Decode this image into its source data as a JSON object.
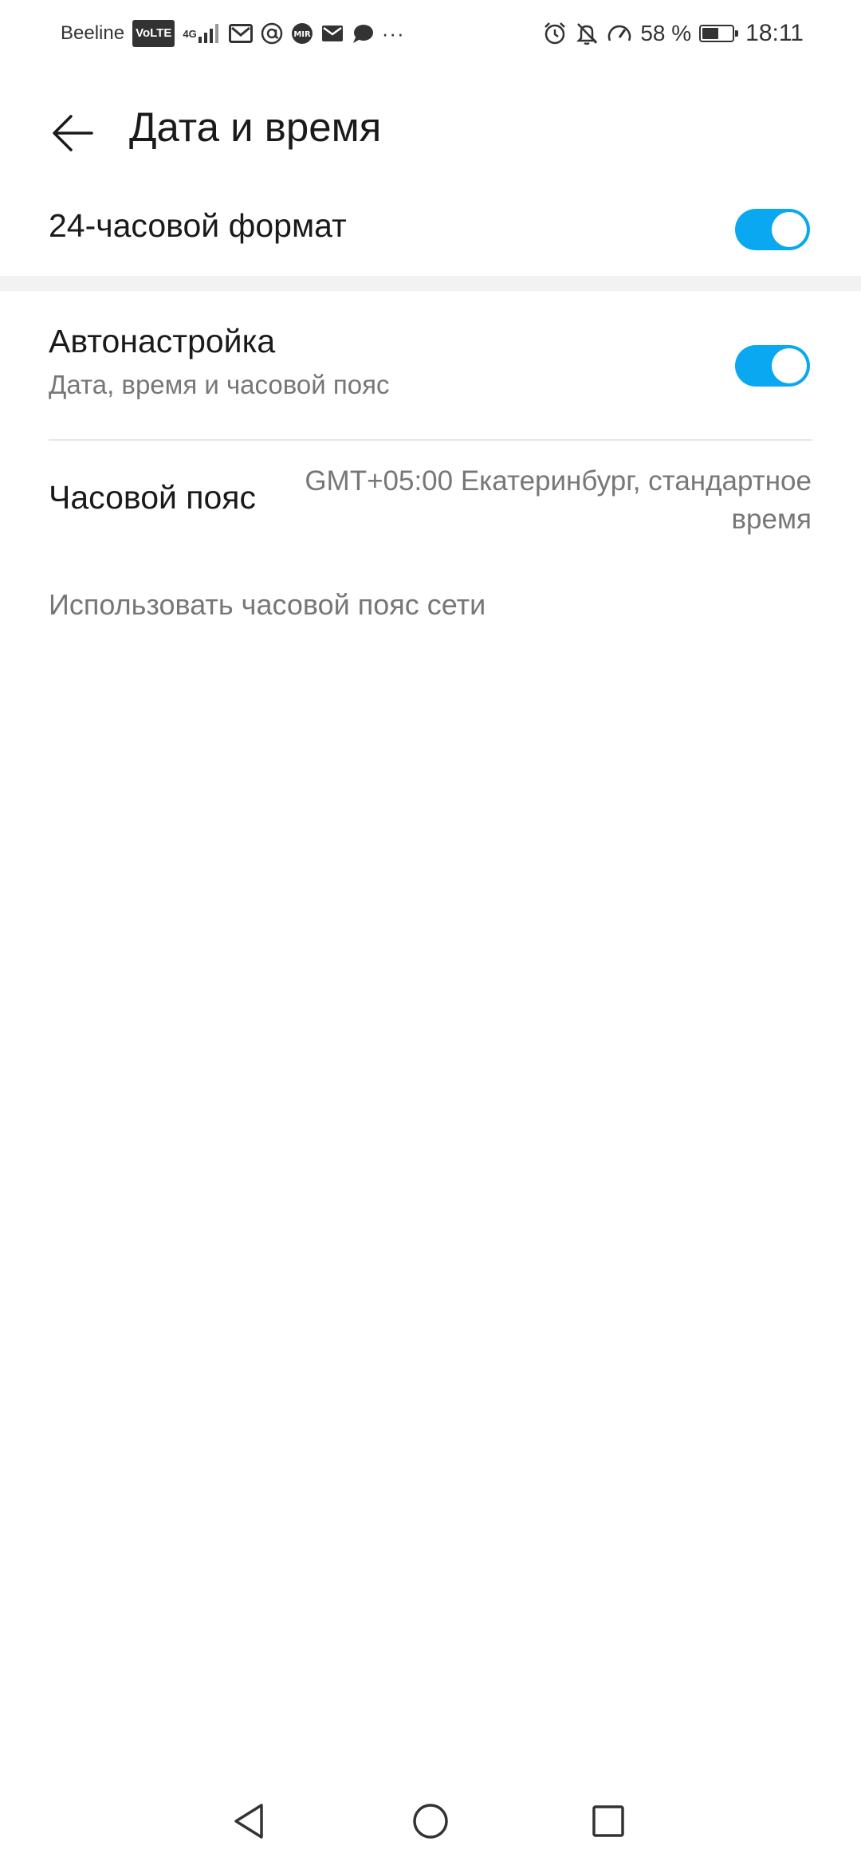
{
  "status_bar": {
    "carrier": "Beeline",
    "volte": "VoLTE",
    "network": "4G",
    "battery_percent": "58 %",
    "battery_level": 0.58,
    "time": "18:11",
    "more": "···"
  },
  "header": {
    "title": "Дата и время"
  },
  "settings": {
    "format24": {
      "label": "24-часовой формат",
      "enabled": true
    },
    "auto": {
      "label": "Автонастройка",
      "sublabel": "Дата, время и часовой пояс",
      "enabled": true
    },
    "timezone": {
      "label": "Часовой пояс",
      "value_line1": "GMT+05:00 Екатеринбург, стандартное",
      "value_line2": "время"
    },
    "hint": "Использовать часовой пояс сети"
  },
  "colors": {
    "accent": "#0aa8f0",
    "secondary_text": "#777777",
    "primary_text": "#1a1a1a"
  }
}
